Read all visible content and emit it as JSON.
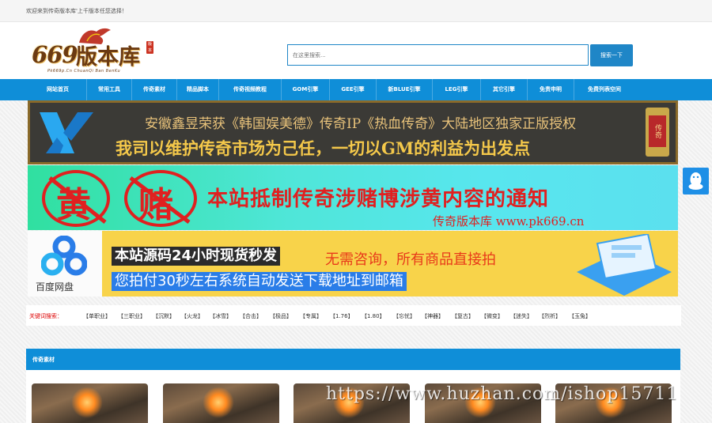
{
  "topbar": {
    "welcome": "欢迎来到传奇版本库'上千版本任您选择！"
  },
  "logo": {
    "main_number": "669",
    "main_text": "版本库",
    "subtitle": "Pk669p.Cn ChuanQi Ban BenKu",
    "seal": "版本库"
  },
  "search": {
    "placeholder": "在这里搜索...",
    "button": "搜索一下"
  },
  "nav": [
    "网站首页",
    "常用工具",
    "传奇素材",
    "精品脚本",
    "传奇视频教程",
    "GOM引擎",
    "GEE引擎",
    "新BLUE引擎",
    "LEG引擎",
    "其它引擎",
    "免责申明",
    "免费列表空间"
  ],
  "banners": {
    "b1_line1": "安徽鑫昱荣获《韩国娱美德》传奇IP《热血传奇》大陆地区独家正版授权",
    "b1_line2": "我司以维护传奇市场为己任，一切以GM的利益为出发点",
    "b1_badge": "传奇",
    "b2_char1": "黄",
    "b2_char2": "赌",
    "b2_title": "本站抵制传奇涉赌博涉黄内容的通知",
    "b2_sub": "传奇版本库  www.pk669.cn",
    "b3_logo_text": "百度网盘",
    "b3_line1": "本站源码24小时现货秒发",
    "b3_line1b": "无需咨询，所有商品直接拍",
    "b3_line2": "您拍付30秒左右系统自动发送下载地址到邮箱"
  },
  "keywords": {
    "label": "关键词搜索：",
    "items": [
      "【单职业】",
      "【三职业】",
      "【沉默】",
      "【火龙】",
      "【冰雪】",
      "【合击】",
      "【极品】",
      "【专属】",
      "【1.76】",
      "【1.80】",
      "【忘忧】",
      "【神器】",
      "【复古】",
      "【微变】",
      "【迷失】",
      "【烈祈】",
      "【玉兔】"
    ]
  },
  "section": {
    "title": "传奇素材"
  },
  "watermark": "https://www.huzhan.com/ishop15711",
  "colors": {
    "nav_blue": "#0f8ed8",
    "search_border": "#1f86c7",
    "keyword_label": "#dd0000"
  }
}
